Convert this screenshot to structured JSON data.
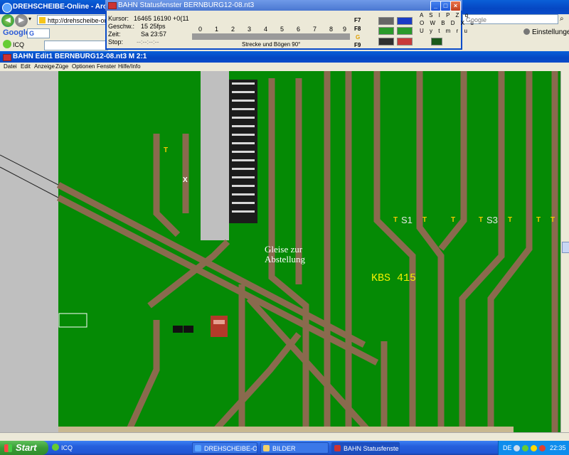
{
  "browser": {
    "title": "DREHSCHEIBE-Online - Arcor AG & C",
    "address": "http://drehscheibe-online.d",
    "google_logo": "Google",
    "search_placeholder": "Google",
    "icq_label": "ICQ",
    "settings_label": "Einstellungen"
  },
  "status_window": {
    "title": "BAHN Statusfenster BERNBURG12-08.nt3",
    "labels": {
      "cursor": "Kursor:",
      "speed": "Geschw.:",
      "time": "Zeit:",
      "stop": "Stop:"
    },
    "values": {
      "cursor": "16465 16190 +0(11",
      "speed": "15   25fps",
      "time": "Sa   23:57",
      "stop": "--:--:--:--"
    },
    "digits": [
      "0",
      "1",
      "2",
      "3",
      "4",
      "5",
      "6",
      "7",
      "8",
      "9"
    ],
    "fkeys": [
      "F7",
      "F8",
      "F9"
    ],
    "gkey": "G",
    "caption": "Strecke und Bögen 90°",
    "chars_row1": "A S I P Z q",
    "chars_row2": "O W B D X u",
    "chars_row3": "U y t m r u",
    "colors": {
      "blue": "#1a3cc6",
      "green": "#2a9a2a",
      "red": "#c83a3a",
      "dark": "#303030"
    }
  },
  "main_window": {
    "title": "BAHN Edit1 BERNBURG12-08.nt3 M 2:1",
    "menu": [
      "Datei",
      "Edit",
      "Anzeige",
      "Züge",
      "Optionen",
      "Fenster",
      "Hilfe/Info"
    ]
  },
  "layout_labels": {
    "gleise_line1": "Gleise zur",
    "gleise_line2": "Abstellung",
    "kbs": "KBS 415",
    "s1": "S1",
    "s3": "S3",
    "t_marker": "T",
    "x_marker": "X"
  },
  "taskbar": {
    "start": "Start",
    "quicklaunch": "ICQ",
    "tasks": [
      "DREHSCHEIBE-Online...",
      "BILDER",
      "BAHN Statusfenster ..."
    ],
    "lang": "DE",
    "clock": "22:35"
  }
}
